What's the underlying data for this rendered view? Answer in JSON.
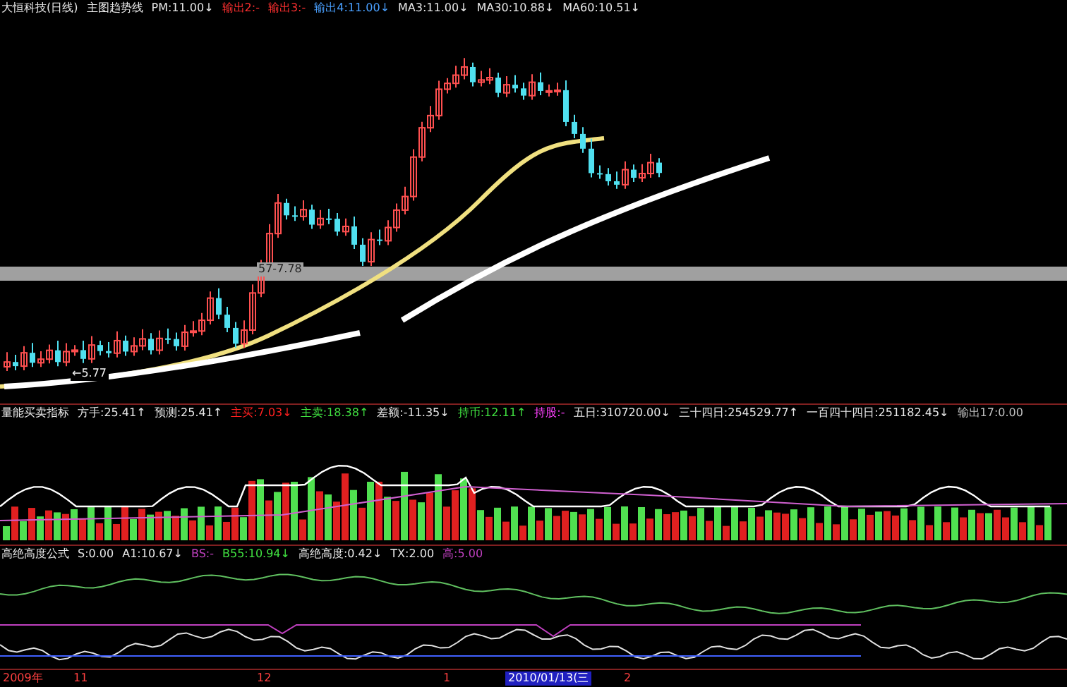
{
  "main_panel": {
    "legend": [
      {
        "text": "大恒科技(日线)",
        "color": "#e8e8e8"
      },
      {
        "text": "主图趋势线",
        "color": "#e8e8e8"
      },
      {
        "text": "PM:11.00↓",
        "color": "#e8e8e8"
      },
      {
        "text": "输出2:-",
        "color": "#ff3030"
      },
      {
        "text": "输出3:-",
        "color": "#ff3030"
      },
      {
        "text": "输出4:11.00↓",
        "color": "#4aa0ff"
      },
      {
        "text": "MA3:11.00↓",
        "color": "#e8e8e8"
      },
      {
        "text": "MA30:10.88↓",
        "color": "#e8e8e8"
      },
      {
        "text": "MA60:10.51↓",
        "color": "#e8e8e8"
      }
    ],
    "price_labels": [
      "57-7.78",
      "←5.77"
    ]
  },
  "volume_panel": {
    "legend": [
      {
        "text": "量能买卖指标",
        "color": "#e8e8e8"
      },
      {
        "text": "方手:25.41↑",
        "color": "#e8e8e8"
      },
      {
        "text": "预测:25.41↑",
        "color": "#e8e8e8"
      },
      {
        "text": "主买:7.03↓",
        "color": "#ff2020"
      },
      {
        "text": "主卖:18.38↑",
        "color": "#40e040"
      },
      {
        "text": "差额:-11.35↓",
        "color": "#e8e8e8"
      },
      {
        "text": "持币:12.11↑",
        "color": "#40e040"
      },
      {
        "text": "持股:-",
        "color": "#ff40ff"
      },
      {
        "text": "五日:310720.00↓",
        "color": "#e8e8e8"
      },
      {
        "text": "三十四日:254529.77↑",
        "color": "#e8e8e8"
      },
      {
        "text": "一百四十四日:251182.45↓",
        "color": "#e8e8e8"
      },
      {
        "text": "输出17:0.00",
        "color": "#c0c0c0"
      }
    ]
  },
  "indicator_panel": {
    "legend": [
      {
        "text": "高绝高度公式",
        "color": "#e8e8e8"
      },
      {
        "text": "S:0.00",
        "color": "#e8e8e8"
      },
      {
        "text": "A1:10.67↓",
        "color": "#e8e8e8"
      },
      {
        "text": "BS:-",
        "color": "#c040c0"
      },
      {
        "text": "B55:10.94↓",
        "color": "#40e040"
      },
      {
        "text": "高绝高度:0.42↓",
        "color": "#e8e8e8"
      },
      {
        "text": "TX:2.00",
        "color": "#e8e8e8"
      },
      {
        "text": "高:5.00",
        "color": "#c040c0"
      }
    ]
  },
  "time_axis": {
    "labels": [
      {
        "text": "2009年",
        "selected": false
      },
      {
        "text": "11",
        "selected": false
      },
      {
        "text": "12",
        "selected": false
      },
      {
        "text": "1",
        "selected": false
      },
      {
        "text": "2010/01/13(三",
        "selected": true
      },
      {
        "text": "2",
        "selected": false
      }
    ]
  }
}
